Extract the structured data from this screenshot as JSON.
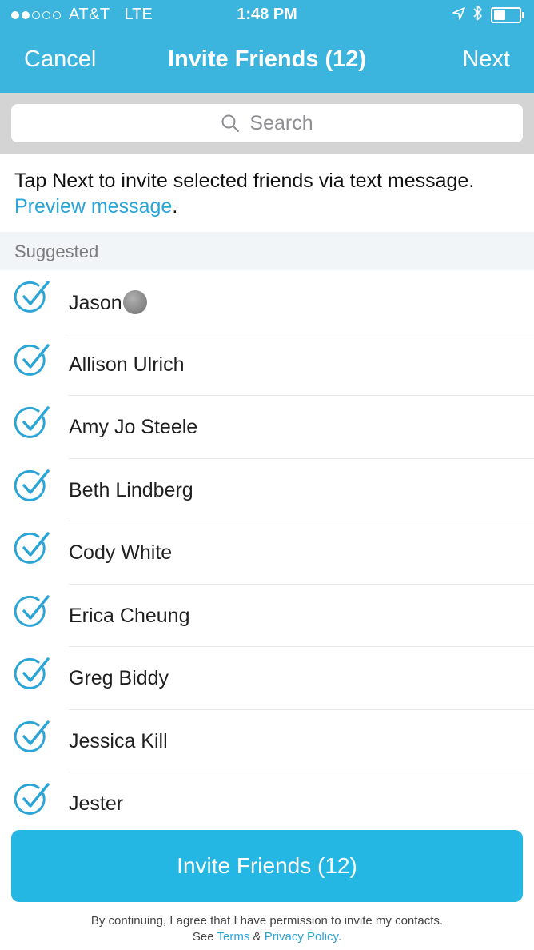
{
  "status_bar": {
    "signal_filled": 2,
    "signal_total": 5,
    "carrier": "AT&T",
    "network": "LTE",
    "time": "1:48 PM",
    "icons": [
      "location-arrow-icon",
      "bluetooth-icon",
      "battery-icon"
    ],
    "battery_level": 0.45
  },
  "nav": {
    "cancel_label": "Cancel",
    "title": "Invite Friends (12)",
    "next_label": "Next"
  },
  "search": {
    "placeholder": "Search",
    "icon": "search-icon"
  },
  "info": {
    "text": "Tap Next to invite selected friends via text message.",
    "preview_link": "Preview message",
    "period": "."
  },
  "section": {
    "label": "Suggested"
  },
  "contacts": [
    {
      "name": "Jason",
      "checked": true,
      "emoji": "smiling-face-with-heart-eyes-emoji"
    },
    {
      "name": "Allison Ulrich",
      "checked": true
    },
    {
      "name": "Amy Jo Steele",
      "checked": true
    },
    {
      "name": "Beth Lindberg",
      "checked": true
    },
    {
      "name": "Cody White",
      "checked": true
    },
    {
      "name": "Erica Cheung",
      "checked": true
    },
    {
      "name": "Greg Biddy",
      "checked": true
    },
    {
      "name": "Jessica Kill",
      "checked": true
    },
    {
      "name": "Jester",
      "checked": true
    }
  ],
  "invite_button": {
    "label": "Invite Friends (12)"
  },
  "footer": {
    "line1": "By continuing, I agree that I have permission to invite my contacts.",
    "see": "See",
    "terms": "Terms",
    "amp": "&",
    "privacy": "Privacy Policy",
    "end": "."
  },
  "colors": {
    "header_bg": "#3bb4de",
    "accent": "#2aa5d8",
    "button_bg": "#25b7e4"
  }
}
